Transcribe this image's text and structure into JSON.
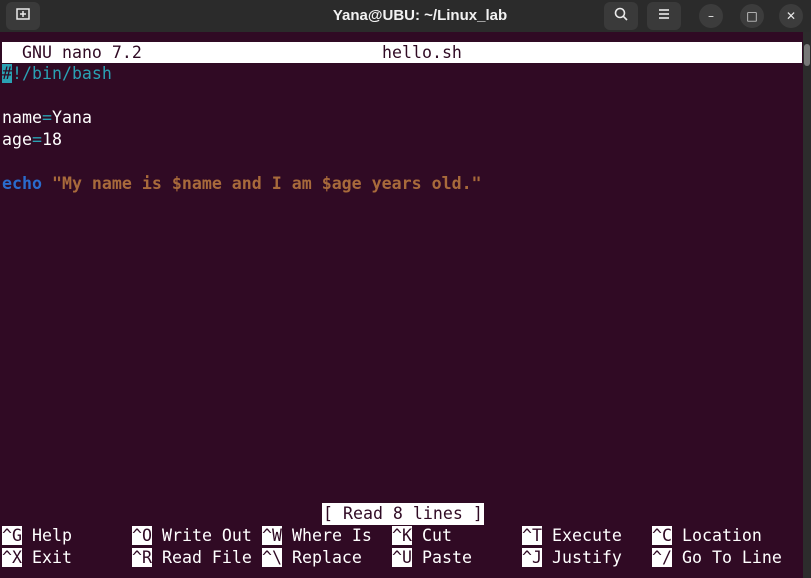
{
  "window": {
    "title": "Yana@UBU: ~/Linux_lab",
    "buttons": {
      "new_tab_icon": "new-tab-icon",
      "search_icon": "search-icon",
      "menu_icon": "hamburger-menu-icon"
    },
    "controls": {
      "minimize": "–",
      "maximize": "□",
      "close": "✕"
    }
  },
  "nano": {
    "version": "GNU nano 7.2",
    "filename": "hello.sh",
    "lines": {
      "l1_hash": "#",
      "l1_rest": "!/bin/bash",
      "l3_name_var": "name",
      "l3_eq": "=",
      "l3_value": "Yana",
      "l4_age_var": "age",
      "l4_eq": "=",
      "l4_value": "18",
      "l6_keyword": "echo",
      "l6_string": "\"My name is $name and I am $age years old.\""
    },
    "status": "[ Read 8 lines ]",
    "shortcuts": [
      {
        "key": "^G",
        "label": "Help"
      },
      {
        "key": "^O",
        "label": "Write Out"
      },
      {
        "key": "^W",
        "label": "Where Is"
      },
      {
        "key": "^K",
        "label": "Cut"
      },
      {
        "key": "^T",
        "label": "Execute"
      },
      {
        "key": "^C",
        "label": "Location"
      },
      {
        "key": "^X",
        "label": "Exit"
      },
      {
        "key": "^R",
        "label": "Read File"
      },
      {
        "key": "^\\",
        "label": "Replace"
      },
      {
        "key": "^U",
        "label": "Paste"
      },
      {
        "key": "^J",
        "label": "Justify"
      },
      {
        "key": "^/",
        "label": "Go To Line"
      }
    ]
  },
  "colors": {
    "terminal_bg": "#300a24",
    "comment": "#2aa1b3",
    "keyword": "#2a6bcc",
    "string": "#a86a3b"
  }
}
